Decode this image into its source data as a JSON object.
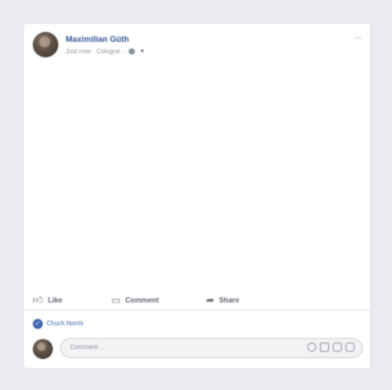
{
  "post": {
    "author": "Maximilian Güth",
    "meta": "Just now · Cologne ·",
    "more_label": "···"
  },
  "actions": {
    "like_label": "Like",
    "comment_label": "Comment",
    "share_label": "Share"
  },
  "reactions": {
    "names": "Chuck Norris"
  },
  "comment_box": {
    "placeholder": "Comment ..."
  },
  "icons": {
    "like": "thumbs-up-icon",
    "comment": "speech-bubble-icon",
    "share": "share-arrow-icon",
    "privacy": "globe-icon",
    "composer": [
      "emoji-icon",
      "camera-icon",
      "gif-icon",
      "sticker-icon"
    ]
  },
  "colors": {
    "background": "#e9ebee",
    "card": "#ffffff",
    "name_link": "#385898",
    "reaction_blue": "#4267b2",
    "muted_text": "#8d949e"
  }
}
